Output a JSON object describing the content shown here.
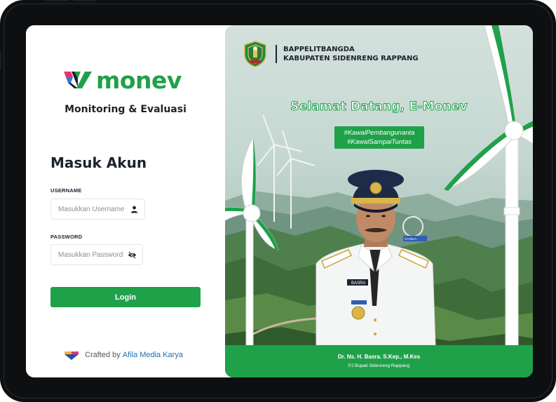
{
  "app": {
    "logo_text": "monev",
    "subtitle": "Monitoring & Evaluasi"
  },
  "login": {
    "heading": "Masuk Akun",
    "username_label": "USERNAME",
    "username_placeholder": "Masukkan Username",
    "password_label": "PASSWORD",
    "password_placeholder": "Masukkan Password",
    "login_label": "Login"
  },
  "footer": {
    "crafted_prefix": "Crafted by",
    "crafted_brand": "Afila Media Karya"
  },
  "hero": {
    "org_line1": "BAPPELITBANGDA",
    "org_line2": "KABUPATEN SIDENRENG RAPPANG",
    "welcome": "Selamat Datang, E-Monev",
    "hashtag1": "#KawalPembangunanta",
    "hashtag2": "#KawalSampaiTuntas",
    "name_tag": "BASRA",
    "person_name": "Dr. Ns. H. Basra. S.Kep., M.Kes",
    "person_role": "PJ Bupati Sidenreng Rappang",
    "sign_text": "CA BILA"
  },
  "colors": {
    "brand_green": "#1fa14a",
    "link_blue": "#1d6fb8",
    "text_dark": "#1c2230"
  },
  "icons": {
    "username_field": "user-icon",
    "password_field": "eye-slash-icon"
  }
}
